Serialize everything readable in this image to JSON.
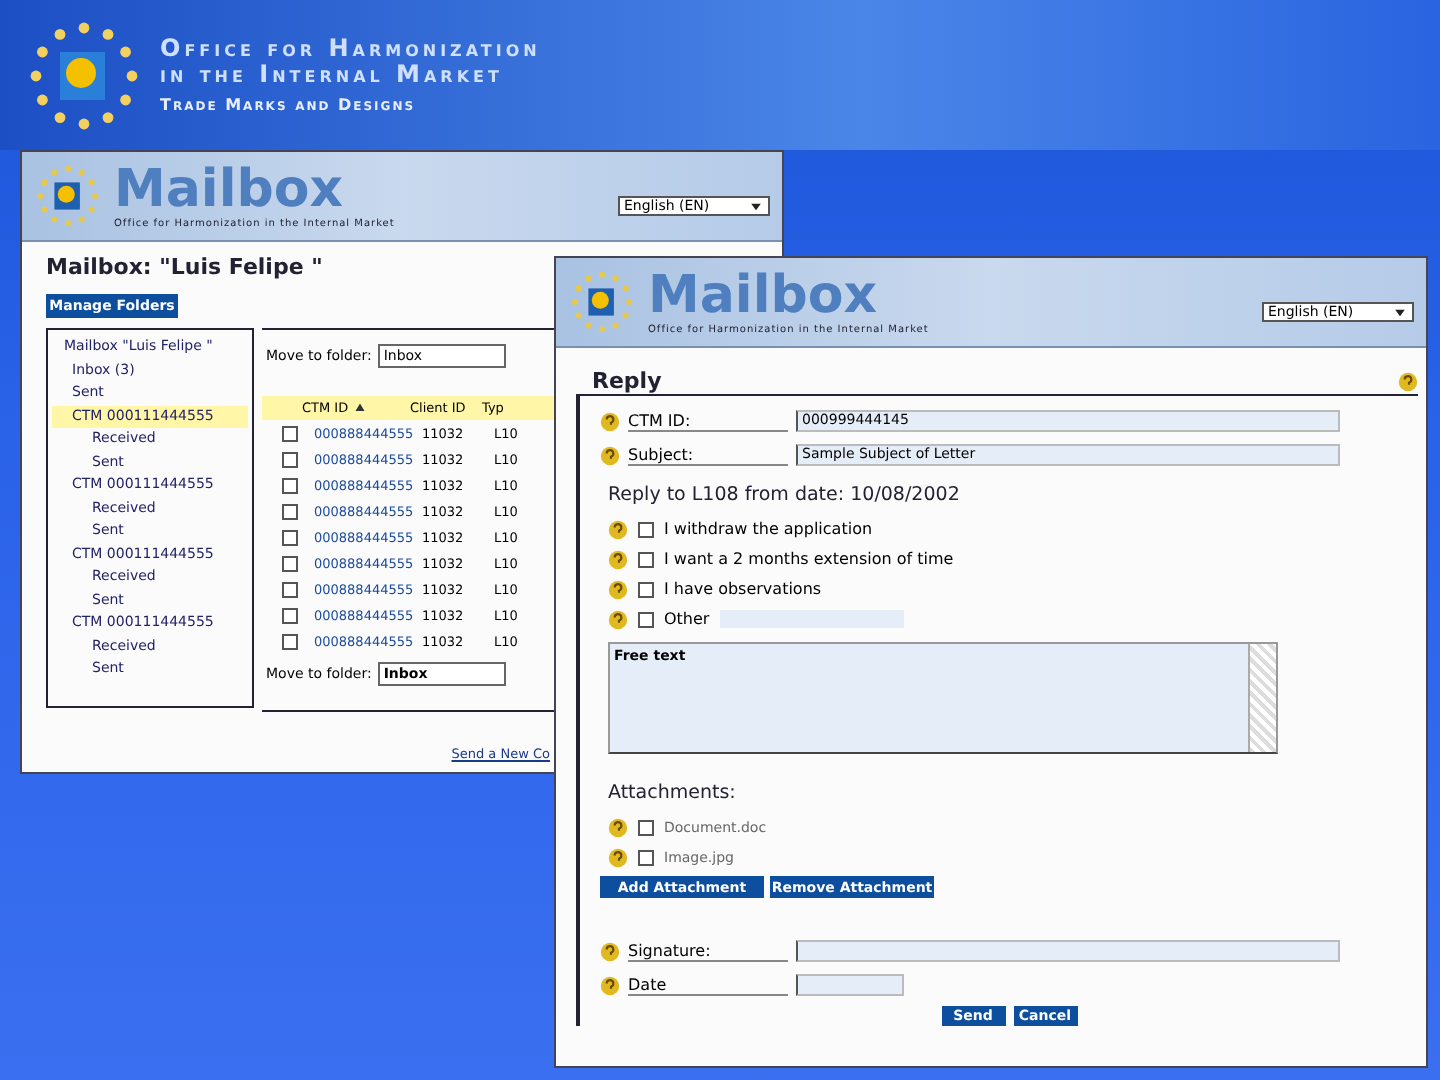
{
  "slide_header": {
    "line1": "Office for Harmonization",
    "line2": "in the Internal Market",
    "line3": "Trade Marks and Designs"
  },
  "mailbox_window": {
    "banner": {
      "title": "Mailbox",
      "subtitle": "Office for Harmonization in the Internal Market",
      "language": "English (EN)"
    },
    "heading": "Mailbox: \"Luis Felipe \"",
    "manage_button": "Manage Folders",
    "tree": [
      {
        "label": "Mailbox \"Luis Felipe \"",
        "selected": false,
        "children": [
          {
            "label": "Inbox (3)",
            "selected": false
          },
          {
            "label": "Sent",
            "selected": false
          },
          {
            "label": "CTM 000111444555",
            "selected": true,
            "children": [
              {
                "label": "Received",
                "selected": false
              },
              {
                "label": "Sent",
                "selected": false
              }
            ]
          },
          {
            "label": "CTM 000111444555",
            "selected": false,
            "children": [
              {
                "label": "Received",
                "selected": false
              },
              {
                "label": "Sent",
                "selected": false
              }
            ]
          },
          {
            "label": "CTM 000111444555",
            "selected": false,
            "children": [
              {
                "label": "Received",
                "selected": false
              },
              {
                "label": "Sent",
                "selected": false
              }
            ]
          },
          {
            "label": "CTM 000111444555",
            "selected": false,
            "children": [
              {
                "label": "Received",
                "selected": false
              },
              {
                "label": "Sent",
                "selected": false
              }
            ]
          }
        ]
      }
    ],
    "move_top": {
      "label": "Move to folder:",
      "value": "Inbox"
    },
    "columns": [
      {
        "label": "CTM ID",
        "sorted": true
      },
      {
        "label": "Client ID",
        "sorted": false
      },
      {
        "label": "Typ",
        "sorted": false
      }
    ],
    "rows": [
      {
        "checked": false,
        "cells": [
          "000888444555",
          "11032",
          "L10"
        ]
      },
      {
        "checked": false,
        "cells": [
          "000888444555",
          "11032",
          "L10"
        ]
      },
      {
        "checked": false,
        "cells": [
          "000888444555",
          "11032",
          "L10"
        ]
      },
      {
        "checked": false,
        "cells": [
          "000888444555",
          "11032",
          "L10"
        ]
      },
      {
        "checked": false,
        "cells": [
          "000888444555",
          "11032",
          "L10"
        ]
      },
      {
        "checked": false,
        "cells": [
          "000888444555",
          "11032",
          "L10"
        ]
      },
      {
        "checked": false,
        "cells": [
          "000888444555",
          "11032",
          "L10"
        ]
      },
      {
        "checked": false,
        "cells": [
          "000888444555",
          "11032",
          "L10"
        ]
      },
      {
        "checked": false,
        "cells": [
          "000888444555",
          "11032",
          "L10"
        ]
      }
    ],
    "move_bottom": {
      "label": "Move to folder:",
      "value": "Inbox"
    },
    "link": "Send a New Co"
  },
  "reply_window": {
    "banner": {
      "title": "Mailbox",
      "subtitle": "Office for Harmonization in the Internal Market",
      "language": "English (EN)"
    },
    "heading": "Reply",
    "fields": [
      {
        "label": "CTM ID:",
        "value": "000999444145"
      },
      {
        "label": "Subject:",
        "value": "Sample Subject of Letter"
      }
    ],
    "reply_heading": "Reply to L108 from date: 10/08/2002",
    "options": [
      {
        "kind": "plain",
        "label": "I withdraw the application",
        "checked": false
      },
      {
        "kind": "plain",
        "label": "I want a 2 months extension of time",
        "checked": false
      },
      {
        "kind": "plain",
        "label": "I have observations",
        "checked": false
      },
      {
        "kind": "other",
        "label": "Other",
        "checked": false
      }
    ],
    "free_text": "Free text",
    "attachments_heading": "Attachments:",
    "attachments": [
      {
        "label": "Document.doc",
        "checked": false
      },
      {
        "label": "Image.jpg",
        "checked": false
      }
    ],
    "attachment_buttons": [
      "Add Attachment",
      "Remove Attachment"
    ],
    "signature_label": "Signature:",
    "date_label": "Date",
    "buttons": [
      "Send",
      "Cancel"
    ]
  }
}
